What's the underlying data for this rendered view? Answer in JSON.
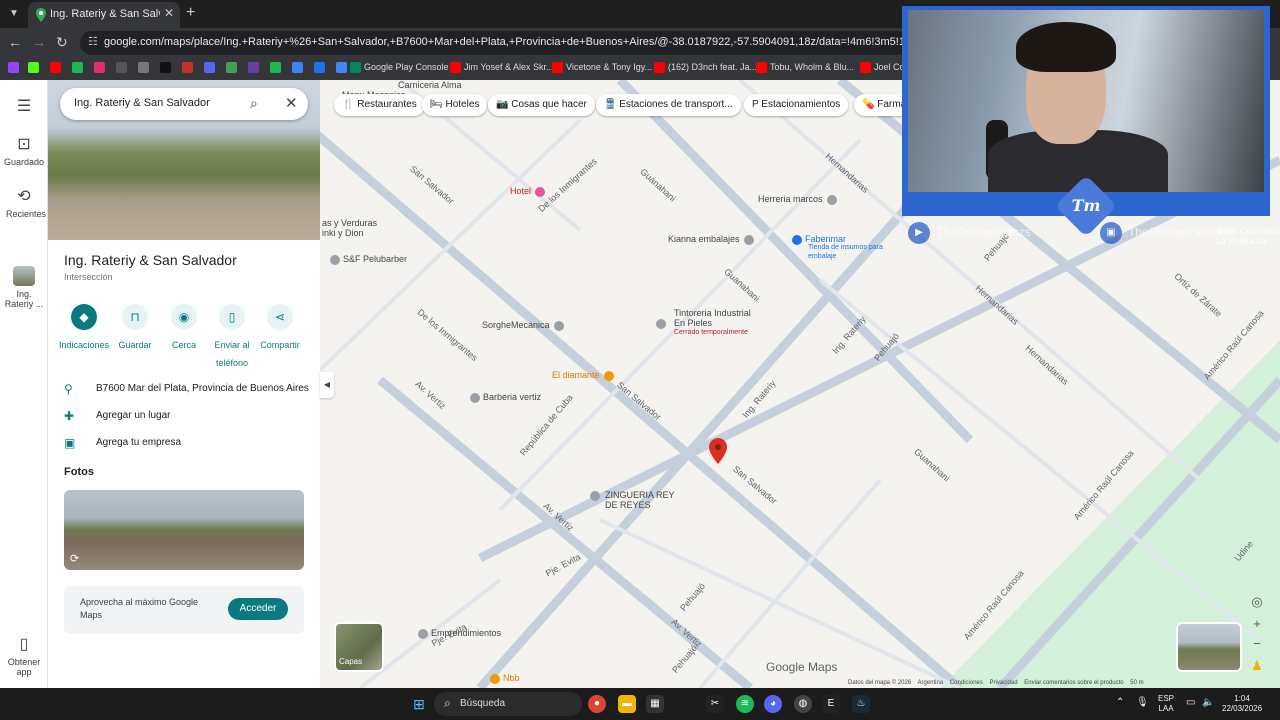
{
  "browser": {
    "tab_title": "Ing. Rateriy & San Salvador - G",
    "url": "google.com/maps/place/Ing.+Rateriy+%26+San+Salvador,+B7600+Mar+del+Plata,+Provincia+de+Buenos+Aires/@-38.0187922,-57.5904091,18z/data=!4m6!3m5!1s0x9584dedcf0db6ddb:0x833",
    "bookmarks": [
      "Google Play Console",
      "Jim Yosef & Alex Skr...",
      "Vicetone & Tony Igy...",
      "(162) D3nch feat. Ja...",
      "Tobu, Wholm & Blu...",
      "Joel Co"
    ]
  },
  "rail": {
    "saved": "Guardado",
    "recent": "Recientes",
    "pinned_place": "Ing. Rateriy ...",
    "get_app": "Obtener app"
  },
  "panel": {
    "search_value": "Ing. Rateriy & San Salvador",
    "title": "Ing. Rateriy & San Salvador",
    "subtitle": "Intersección",
    "actions": [
      "Indicaciones",
      "Guardar",
      "Cerca",
      "Enviar al teléfono",
      "Compartir"
    ],
    "address": "B7600 Mar del Plata, Provincia de Buenos Aires",
    "add_place": "Agregar un lugar",
    "add_business": "Agrega tu empresa",
    "photos_heading": "Fotos",
    "promo_text": "Aprovecha al máximo Google Maps",
    "promo_button": "Acceder"
  },
  "map": {
    "chips": [
      "Restaurantes",
      "Hoteles",
      "Cosas que hacer",
      "Estaciones de transport...",
      "Estacionamientos",
      "Farma"
    ],
    "pois": {
      "hotel": "Hotel",
      "herreria": "Herreria marcos",
      "kianna": "Kianna embalajes",
      "fabenmar": "Fabenmar",
      "fabenmar_sub": "Tienda de insumos para embalaje",
      "sf": "S&F Pelubarber",
      "sorghe": "SorgheMecanica",
      "tintoreria": "Tintoreria Industrial En Pieles",
      "tintoreria_sub": "Cerrado temporalmente",
      "diamante": "El diamante",
      "barberia": "Barberia vertiz",
      "zingueria": "ZINGUERIA REY DE REYES",
      "emprendimientos": "Emprendimientos",
      "nbb": "Nbb",
      "verduras": "as y Verduras",
      "verduras2": "inki y Dion",
      "carniceria": "Carniceria Alma",
      "mapu": "Mapu Mecanica",
      "taller": "Taller Customizados",
      "taller2": "La Bonita sa"
    },
    "streets": {
      "san_salvador": "San Salvador",
      "de_los_inmigrantes": "De los Inmigrantes",
      "guanahani": "Guanahani",
      "hernandarias": "Hernandarias",
      "ing_rateriy": "Ing. Rateriy",
      "pehuajo": "Pehuajó",
      "av_vertiz": "Av. Vertiz",
      "republica_de_cuba": "República de Cuba",
      "america_raul_canosa": "Américo Raúl Canosa",
      "pje_evita": "Pje. Evita",
      "ortiz_de_zarate": "Ortiz de Zárate",
      "udine": "Udine"
    },
    "layers_label": "Capas",
    "logo": "Google Maps",
    "footer": [
      "Datos del mapa © 2026",
      "Argentina",
      "Condiciones",
      "Privacidad",
      "Enviar comentarios sobre el producto",
      "50 m"
    ]
  },
  "overlay": {
    "logo": "Tm",
    "youtube_handle": "TheGeorgeHanzs",
    "twitch_handle": "TheGeorgeHanzs"
  },
  "taskbar": {
    "search": "Búsqueda",
    "lang": "ESP",
    "lang2": "LAA",
    "time": "1:04",
    "date": "22/03/2026"
  },
  "colors": {
    "accent": "#0b7a80",
    "map_bg": "#f5f3f0",
    "road": "#c6d0dc",
    "pin": "#d93025",
    "overlay": "#2e66cf"
  }
}
